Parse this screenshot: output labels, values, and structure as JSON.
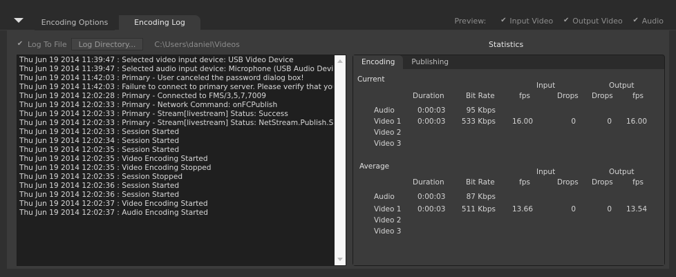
{
  "tabs": {
    "encoding_options": "Encoding Options",
    "encoding_log": "Encoding Log"
  },
  "preview": {
    "label": "Preview:",
    "input_video": "Input Video",
    "output_video": "Output Video",
    "audio": "Audio"
  },
  "logbar": {
    "log_to_file": "Log To File",
    "log_directory": "Log Directory...",
    "path": "C:\\Users\\daniel\\Videos"
  },
  "log_lines": [
    "Thu Jun 19 2014 11:39:47 : Selected video input device: USB Video Device",
    "Thu Jun 19 2014 11:39:47 : Selected audio input device: Microphone (USB Audio Device)",
    "Thu Jun 19 2014 11:42:03 : Primary - User canceled the password dialog box!",
    "Thu Jun 19 2014 11:42:03 : Failure to connect to primary server. Please verify that your Serve",
    "Thu Jun 19 2014 12:02:28 : Primary - Connected to FMS/3,5,7,7009",
    "Thu Jun 19 2014 12:02:33 : Primary - Network Command: onFCPublish",
    "Thu Jun 19 2014 12:02:33 : Primary - Stream[livestream] Status: Success",
    "Thu Jun 19 2014 12:02:33 : Primary - Stream[livestream] Status: NetStream.Publish.Start",
    "Thu Jun 19 2014 12:02:33 : Session Started",
    "Thu Jun 19 2014 12:02:34 : Session Started",
    "Thu Jun 19 2014 12:02:35 : Session Started",
    "Thu Jun 19 2014 12:02:35 : Video Encoding Started",
    "Thu Jun 19 2014 12:02:35 : Video Encoding Stopped",
    "Thu Jun 19 2014 12:02:35 : Session Stopped",
    "Thu Jun 19 2014 12:02:36 : Session Started",
    "Thu Jun 19 2014 12:02:36 : Session Started",
    "Thu Jun 19 2014 12:02:37 : Video Encoding Started",
    "Thu Jun 19 2014 12:02:37 : Audio Encoding Started"
  ],
  "statistics": {
    "title": "Statistics",
    "tabs": {
      "encoding": "Encoding",
      "publishing": "Publishing"
    },
    "headers": {
      "input": "Input",
      "output": "Output",
      "duration": "Duration",
      "bit_rate": "Bit Rate",
      "fps": "fps",
      "drops": "Drops"
    },
    "current": {
      "label": "Current",
      "audio": {
        "name": "Audio",
        "duration": "0:00:03",
        "bit_rate": "95 Kbps"
      },
      "video1": {
        "name": "Video 1",
        "duration": "0:00:03",
        "bit_rate": "533 Kbps",
        "in_fps": "16.00",
        "in_drops": "0",
        "out_drops": "0",
        "out_fps": "16.00"
      },
      "video2": {
        "name": "Video 2"
      },
      "video3": {
        "name": "Video 3"
      }
    },
    "average": {
      "label": "Average",
      "audio": {
        "name": "Audio",
        "duration": "0:00:03",
        "bit_rate": "87 Kbps"
      },
      "video1": {
        "name": "Video 1",
        "duration": "0:00:03",
        "bit_rate": "511 Kbps",
        "in_fps": "13.66",
        "in_drops": "0",
        "out_drops": "0",
        "out_fps": "13.54"
      },
      "video2": {
        "name": "Video 2"
      },
      "video3": {
        "name": "Video 3"
      }
    }
  }
}
